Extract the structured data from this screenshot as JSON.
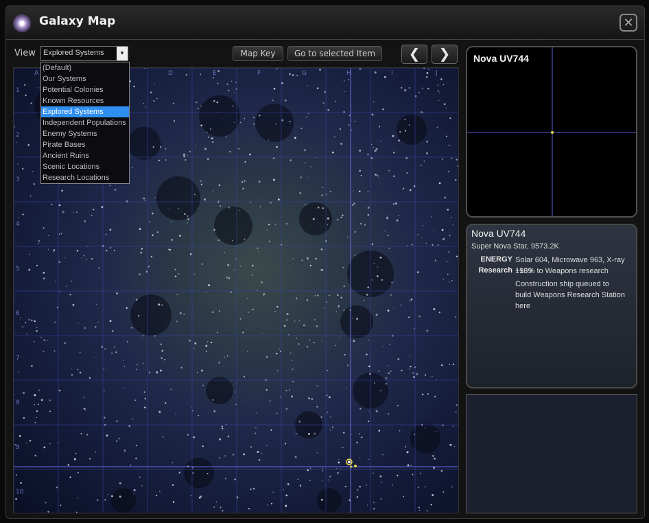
{
  "window": {
    "title": "Galaxy Map",
    "icon": "galaxy-icon",
    "close_icon": "close-icon",
    "close_glyph": "✕"
  },
  "view": {
    "label": "View",
    "selected": "Explored Systems",
    "arrow_glyph": "▾",
    "options": [
      "(Default)",
      "Our Systems",
      "Potential Colonies",
      "Known Resources",
      "Explored Systems",
      "Independent Populations",
      "Enemy Systems",
      "Pirate Bases",
      "Ancient Ruins",
      "Scenic Locations",
      "Research Locations"
    ],
    "selected_index": 4
  },
  "toolbar": {
    "map_key": "Map Key",
    "goto": "Go to selected Item",
    "prev_glyph": "❮",
    "next_glyph": "❯"
  },
  "map": {
    "col_labels": [
      "A",
      "B",
      "C",
      "D",
      "E",
      "F",
      "G",
      "H",
      "I",
      "J"
    ],
    "row_labels": [
      "1",
      "2",
      "3",
      "4",
      "5",
      "6",
      "7",
      "8",
      "9",
      "10"
    ]
  },
  "preview": {
    "name": "Nova UV744"
  },
  "info": {
    "name": "Nova UV744",
    "subtitle": "Super Nova Star, 9573.2K",
    "energy_label": "ENERGY",
    "research_label": "Research",
    "energy_text": "Solar 604, Microwave 963, X-ray 1939",
    "research_text": "+16% to Weapons research",
    "note": "Construction ship queued to build Weapons Research Station here"
  },
  "colors": {
    "selection": "#2f8ff0",
    "crosshair": "#6a6ae8",
    "marker": "#e8d84a"
  }
}
